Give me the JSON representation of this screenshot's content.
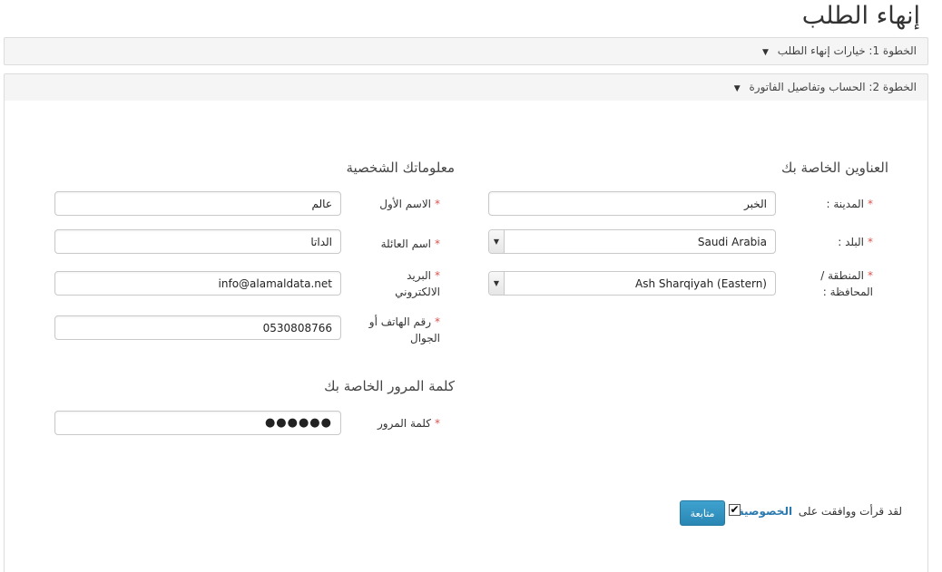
{
  "page": {
    "title": "إنهاء الطلب"
  },
  "steps": {
    "step1": {
      "label": "الخطوة 1: خيارات إنهاء الطلب",
      "caret": "▼"
    },
    "step2": {
      "label": "الخطوة 2: الحساب وتفاصيل الفاتورة",
      "caret": "▼"
    }
  },
  "address": {
    "heading": "العناوين الخاصة بك",
    "city": {
      "label": "المدينة :",
      "value": "الخبر"
    },
    "country": {
      "label": "البلد :",
      "value": "Saudi Arabia",
      "arrow": "▼"
    },
    "region": {
      "label": "المنطقة / المحافظة :",
      "value": "Ash Sharqiyah (Eastern)",
      "arrow": "▼"
    }
  },
  "personal": {
    "heading": "معلوماتك الشخصية",
    "first_name": {
      "label": "الاسم الأول",
      "value": "عالم"
    },
    "last_name": {
      "label": "اسم العائلة",
      "value": "الداتا"
    },
    "email": {
      "label": "البريد الالكتروني",
      "value": "info@alamaldata.net"
    },
    "phone": {
      "label": "رقم الهاتف أو الجوال",
      "value": "0530808766"
    }
  },
  "password": {
    "heading": "كلمة المرور الخاصة بك",
    "field": {
      "label": "كلمة المرور",
      "value": "●●●●●●"
    }
  },
  "required_mark": "*",
  "agreement": {
    "text": "لقد قرأت ووافقت على",
    "link": "الخصوصية",
    "checked": true,
    "check_glyph": "✔"
  },
  "continue_button": {
    "label": "متابعة"
  },
  "colors": {
    "accent": "#2a86b4",
    "required": "#d9534f",
    "link": "#2a7ab0"
  }
}
